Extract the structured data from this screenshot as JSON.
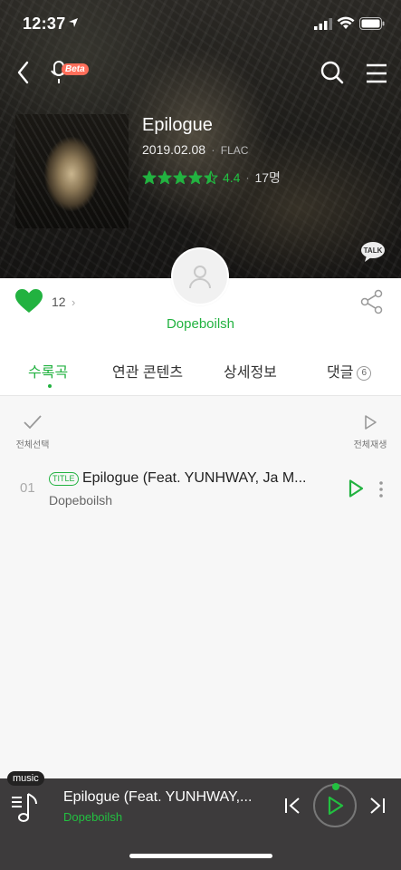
{
  "status_bar": {
    "time": "12:37"
  },
  "header": {
    "beta_label": "Beta"
  },
  "album": {
    "title": "Epilogue",
    "date": "2019.02.08",
    "separator": "·",
    "format": "FLAC",
    "rating_value": "4.4",
    "rating_stars": 4.5,
    "rating_count": "17명",
    "talk_label": "TALK"
  },
  "artist": {
    "name": "Dopeboilsh"
  },
  "like": {
    "count": "12"
  },
  "tabs": [
    {
      "label": "수록곡"
    },
    {
      "label": "연관 콘텐츠"
    },
    {
      "label": "상세정보"
    },
    {
      "label": "댓글",
      "badge": "6"
    }
  ],
  "list_controls": {
    "select_all": "전체선택",
    "play_all": "전체재생"
  },
  "tracks": [
    {
      "number": "01",
      "badge": "TITLE",
      "title": "Epilogue (Feat. YUNHWAY, Ja M...",
      "artist": "Dopeboilsh"
    }
  ],
  "player": {
    "tag": "music",
    "title": "Epilogue (Feat. YUNHWAY,...",
    "artist": "Dopeboilsh"
  },
  "colors": {
    "accent": "#22b240",
    "player_bg": "#3d3b3c"
  }
}
